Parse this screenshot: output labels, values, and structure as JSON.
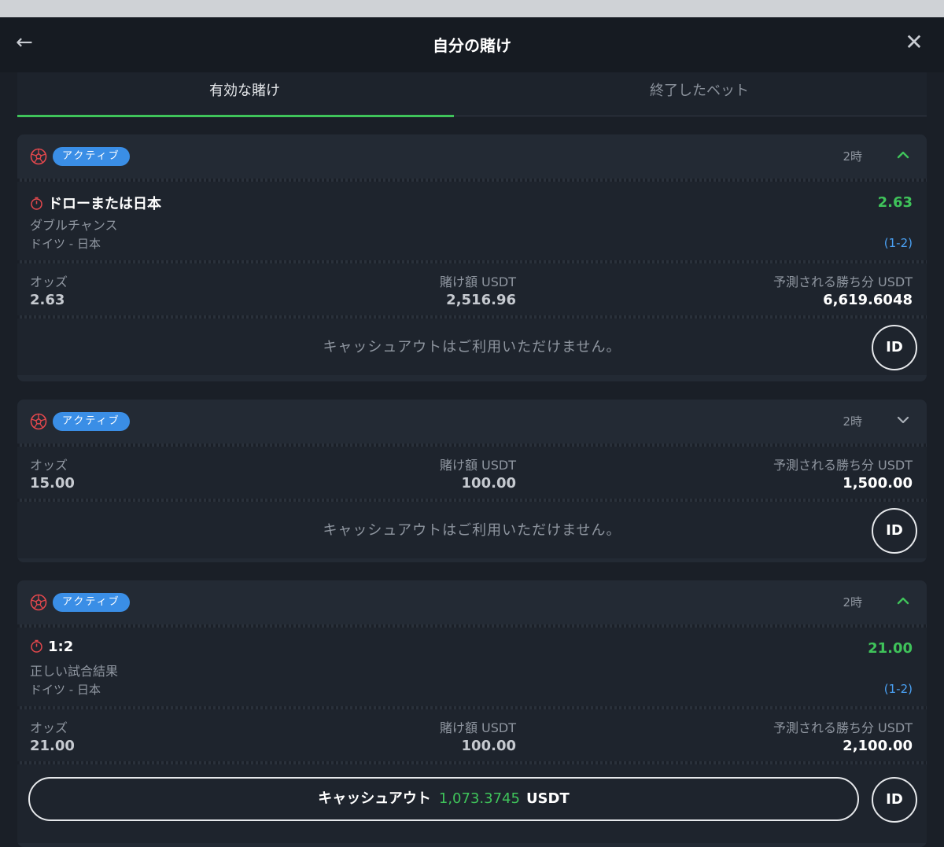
{
  "header": {
    "title": "自分の賭け",
    "back_icon": "arrow-left-icon",
    "close_icon": "close-icon"
  },
  "tabs": [
    {
      "label": "有効な賭け",
      "active": true
    },
    {
      "label": "終了したベット",
      "active": false
    }
  ],
  "colors": {
    "accent_green": "#3fc35a",
    "badge_blue": "#3a8ee6",
    "score_blue": "#4aa0f2",
    "timer_red": "#e5484d"
  },
  "labels": {
    "odds": "オッズ",
    "stake": "賭け額 USDT",
    "payout": "予測される勝ち分 USDT",
    "cashout_unavailable": "キャッシュアウトはご利用いただけません。",
    "id": "ID"
  },
  "bets": [
    {
      "badge": "アクティブ",
      "time": "2時",
      "expanded": true,
      "selection": {
        "title": "ドローまたは日本",
        "odds": "2.63",
        "market": "ダブルチャンス",
        "match": "ドイツ - 日本",
        "score": "(1-2)"
      },
      "odds": "2.63",
      "stake": "2,516.96",
      "payout": "6,619.6048",
      "cashout_available": false
    },
    {
      "badge": "アクティブ",
      "time": "2時",
      "expanded": false,
      "odds": "15.00",
      "stake": "100.00",
      "payout": "1,500.00",
      "cashout_available": false
    },
    {
      "badge": "アクティブ",
      "time": "2時",
      "expanded": true,
      "selection": {
        "title": "1:2",
        "odds": "21.00",
        "market": "正しい試合結果",
        "match": "ドイツ - 日本",
        "score": "(1-2)"
      },
      "odds": "21.00",
      "stake": "100.00",
      "payout": "2,100.00",
      "cashout_available": true,
      "cashout": {
        "label": "キャッシュアウト",
        "amount": "1,073.3745",
        "currency": "USDT"
      }
    }
  ]
}
